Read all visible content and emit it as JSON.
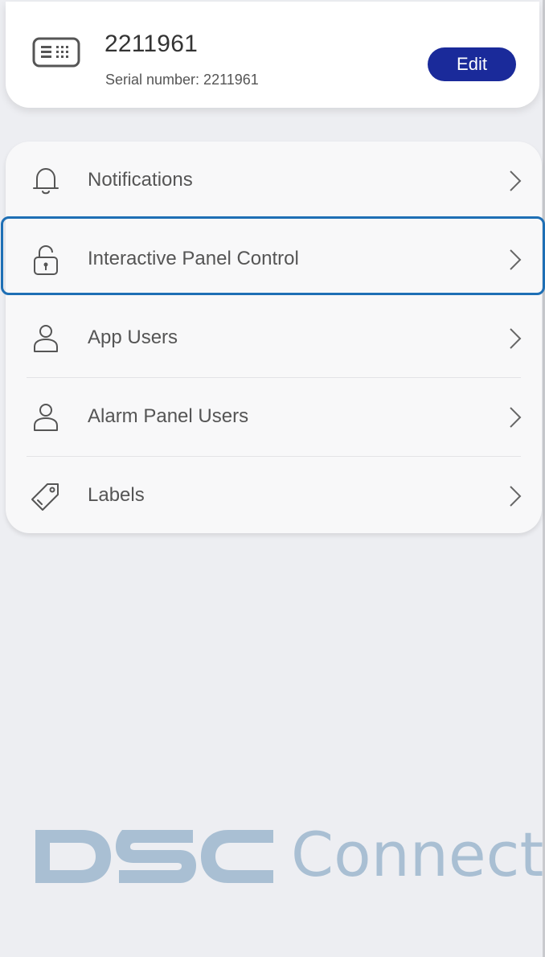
{
  "device": {
    "name": "2211961",
    "serial_label": "Serial number: 2211961",
    "edit_label": "Edit"
  },
  "menu": {
    "items": [
      {
        "label": "Notifications",
        "icon": "bell-icon"
      },
      {
        "label": "Interactive Panel Control",
        "icon": "unlocked-padlock-icon"
      },
      {
        "label": "App Users",
        "icon": "user-icon"
      },
      {
        "label": "Alarm Panel Users",
        "icon": "user-icon"
      },
      {
        "label": "Labels",
        "icon": "tag-icon"
      }
    ],
    "selected": "Interactive Panel Control"
  },
  "logo": {
    "brand": "DSC",
    "product": "Connect",
    "color": "#a9bfd3"
  },
  "colors": {
    "accent": "#1a2a9a",
    "selection": "#1e6fb5",
    "background": "#edeef2"
  }
}
